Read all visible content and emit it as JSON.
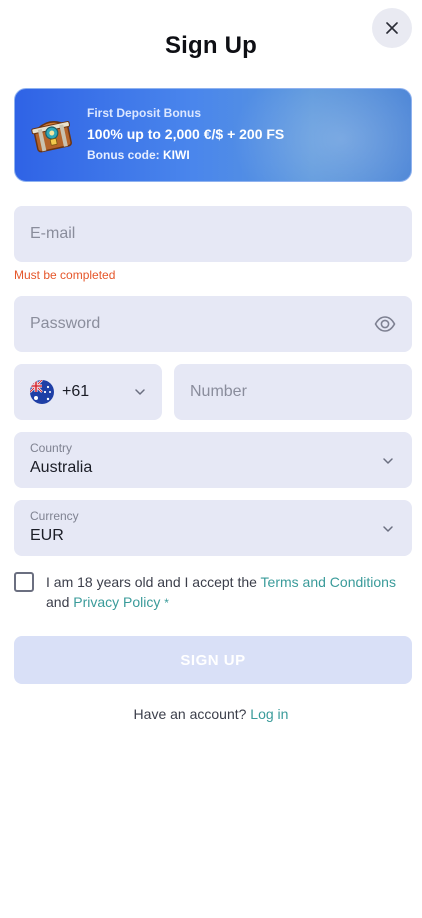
{
  "header": {
    "title": "Sign Up",
    "close_icon": "close-icon"
  },
  "bonus": {
    "heading": "First Deposit Bonus",
    "offer": "100% up to 2,000 €/$ + 200 FS",
    "code_label": "Bonus code:",
    "code_value": "KIWI",
    "icon": "treasure-chest-icon"
  },
  "form": {
    "email_placeholder": "E-mail",
    "email_error": "Must be completed",
    "password_placeholder": "Password",
    "password_toggle_icon": "eye-icon",
    "phone_code": "+61",
    "phone_flag_icon": "australia-flag-icon",
    "number_placeholder": "Number",
    "country_label": "Country",
    "country_value": "Australia",
    "currency_label": "Currency",
    "currency_value": "EUR",
    "terms_prefix": "I am 18 years old and I accept the",
    "terms_link": "Terms and Conditions",
    "terms_and": "and",
    "privacy_link": "Privacy Policy",
    "required_mark": "*",
    "submit_label": "SIGN UP"
  },
  "footer": {
    "have_account": "Have an account?",
    "login_link": "Log in"
  },
  "colors": {
    "accent_link": "#3a9b9a",
    "error": "#e5562a",
    "field_bg": "#e6e8f5",
    "bonus_gradient_start": "#2f63e6",
    "bonus_gradient_end": "#4a84d6",
    "button_disabled": "#d9e0f7"
  }
}
